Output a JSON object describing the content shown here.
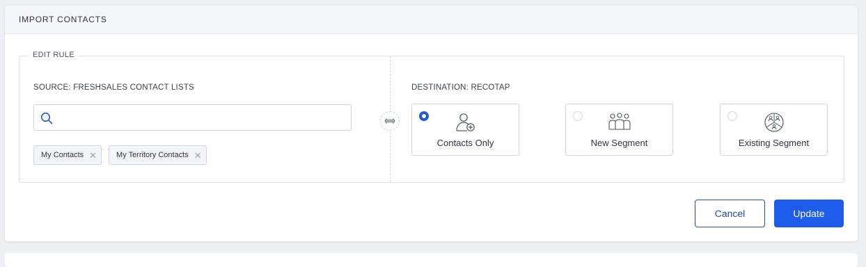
{
  "header": {
    "title": "IMPORT CONTACTS"
  },
  "rule": {
    "legend": "EDIT RULE",
    "source": {
      "label": "SOURCE: FRESHSALES CONTACT LISTS",
      "search_value": "",
      "tags": [
        {
          "label": "My Contacts",
          "remove_icon": "close-icon"
        },
        {
          "label": "My Territory Contacts",
          "remove_icon": "close-icon"
        }
      ]
    },
    "swap_icon": "swap-arrows-icon",
    "destination": {
      "label": "DESTINATION: RECOTAP",
      "options": [
        {
          "label": "Contacts Only",
          "selected": true,
          "icon": "add-user-icon"
        },
        {
          "label": "New Segment",
          "selected": false,
          "icon": "group-icon"
        },
        {
          "label": "Existing Segment",
          "selected": false,
          "icon": "segment-circle-icon"
        }
      ]
    }
  },
  "actions": {
    "cancel_label": "Cancel",
    "update_label": "Update"
  },
  "colors": {
    "primary": "#1d5bea",
    "cancel_border": "#1f4fa8",
    "header_bg": "#f4f6f9",
    "page_bg": "#eef0f3"
  }
}
